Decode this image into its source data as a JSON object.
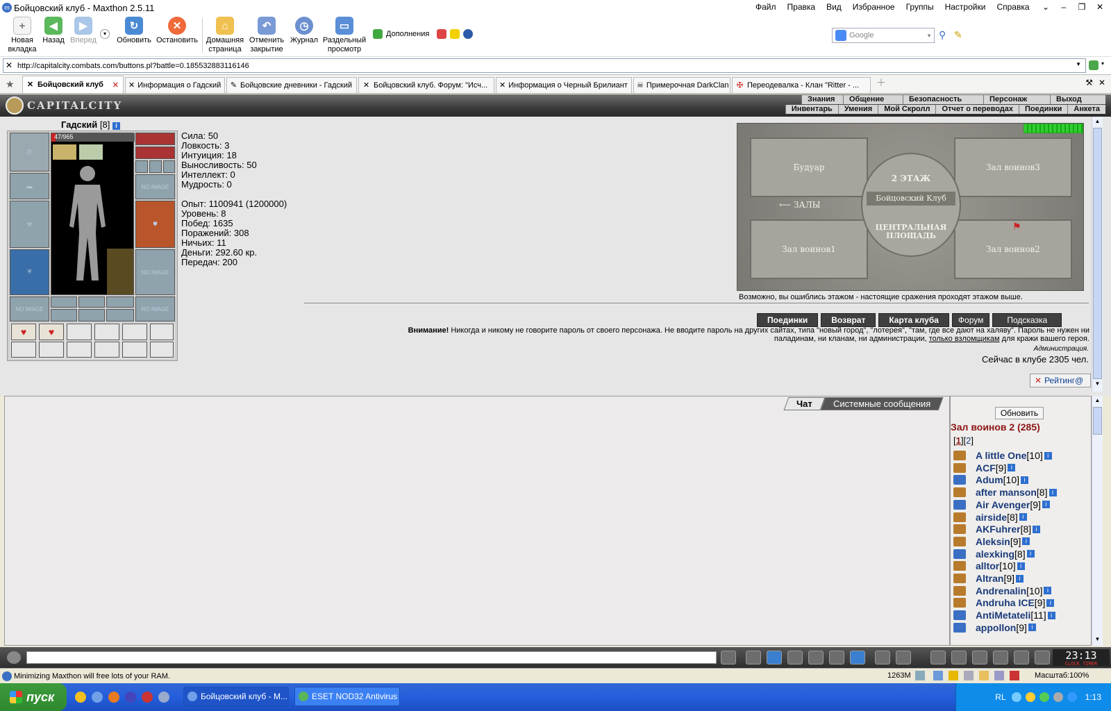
{
  "window": {
    "title": "Бойцовский клуб - Maxthon 2.5.11"
  },
  "menu": [
    "Файл",
    "Правка",
    "Вид",
    "Избранное",
    "Группы",
    "Настройки",
    "Справка"
  ],
  "toolbar": {
    "new_tab": "Новая вкладка",
    "back": "Назад",
    "forward": "Вперед",
    "refresh": "Обновить",
    "stop": "Остановить",
    "home": "Домашняя страница",
    "undo_close": "Отменить закрытие",
    "history": "Журнал",
    "split_view": "Раздельный просмотр",
    "addons": "Дополнения",
    "search_placeholder": "Google"
  },
  "address": {
    "url": "http://capitalcity.combats.com/buttons.pl?battle=0.185532883116146"
  },
  "tabs": [
    {
      "label": "Бойцовский клуб",
      "active": true
    },
    {
      "label": "Информация о Гадский"
    },
    {
      "label": "Бойцовские дневники - Гадский"
    },
    {
      "label": "Бойцовский клуб. Форум: \"Исч..."
    },
    {
      "label": "Информация о Черный Брилиант"
    },
    {
      "label": "Примерочная DarkClan"
    },
    {
      "label": "Переодевалка - Клан \"Ritter - ..."
    }
  ],
  "game": {
    "logo": "CAPITALCITY",
    "nav_top": [
      "Знания",
      "Общение",
      "Безопасность",
      "Персонаж",
      "Выход"
    ],
    "nav_bottom": [
      "Инвентарь",
      "Умения",
      "Мой Скролл",
      "Отчет о переводах",
      "Поединки",
      "Анкета"
    ],
    "character": {
      "name": "Гадский",
      "level": "[8]",
      "hp": "47/965"
    },
    "stats": [
      "Сила: 50",
      "Ловкость: 3",
      "Интуиция: 18",
      "Выносливость: 50",
      "Интеллект: 0",
      "Мудрость: 0",
      "",
      "Опыт: 1100941 (1200000)",
      "Уровень: 8",
      "Побед: 1635",
      "Поражений: 308",
      "Ничьих: 11",
      "Деньги: 292.60 кр.",
      "Передач: 200"
    ],
    "no_image": "NO IMAGE",
    "map": {
      "floor": "2 ЭТАЖ",
      "center": "Бойцовский Клуб",
      "square": "ЦЕНТРАЛЬНАЯ ПЛОЩАДЬ",
      "rooms": [
        "Будуар",
        "Зал воинов3",
        "Зал воинов1",
        "Зал воинов2"
      ],
      "halls": "ЗАЛЫ"
    },
    "map_hint": "Возможно, вы ошиблись этажом - настоящие сражения проходят этажом выше.",
    "buttons": [
      "Поединки",
      "Возврат",
      "Карта клуба",
      "Форум",
      "Подсказка"
    ],
    "warning_bold": "Внимание!",
    "warning_1": "Никогда и никому не говорите пароль от своего персонажа. Не вводите пароль на других сайтах, типа \"новый город\", \"лотерея\", \"там, где все дают на халяву\". Пароль не нужен ни",
    "warning_2a": "паладинам, ни кланам, ни администрации,",
    "warning_link": "только взломщикам",
    "warning_2b": "для кражи вашего героя.",
    "admin": "Администрация.",
    "online": "Сейчас в клубе 2305 чел.",
    "rating": "Рейтинг@"
  },
  "chat": {
    "tabs": [
      "Чат",
      "Системные сообщения"
    ]
  },
  "users": {
    "refresh": "Обновить",
    "room": "Зал воинов 2 (285)",
    "pages": [
      "1",
      "2"
    ],
    "list": [
      {
        "name": "A little One",
        "level": "[10]"
      },
      {
        "name": "ACF",
        "level": "[9]"
      },
      {
        "name": "Adum",
        "level": "[10]"
      },
      {
        "name": "after manson",
        "level": "[8]"
      },
      {
        "name": "Air Avenger",
        "level": "[9]"
      },
      {
        "name": "airside",
        "level": "[8]"
      },
      {
        "name": "AKFuhrer",
        "level": "[8]"
      },
      {
        "name": "Aleksin",
        "level": "[9]"
      },
      {
        "name": "alexking",
        "level": "[8]"
      },
      {
        "name": "alltor",
        "level": "[10]"
      },
      {
        "name": "Altran",
        "level": "[9]"
      },
      {
        "name": "Andrenalin",
        "level": "[10]"
      },
      {
        "name": "Andruha ICE",
        "level": "[9]"
      },
      {
        "name": "AntiMetateli",
        "level": "[11]"
      },
      {
        "name": "appollon",
        "level": "[9]"
      }
    ]
  },
  "clock": {
    "time": "23:13",
    "labels": "CLOCK TIMER"
  },
  "status": {
    "message": "Minimizing Maxthon will free lots of your RAM.",
    "memory": "1263M",
    "zoom": "Масштаб:100%"
  },
  "taskbar": {
    "start": "пуск",
    "tasks": [
      "Бойцовский клуб - M...",
      "ESET NOD32 Antivirus"
    ],
    "lang": "RL",
    "time": "1:13"
  }
}
